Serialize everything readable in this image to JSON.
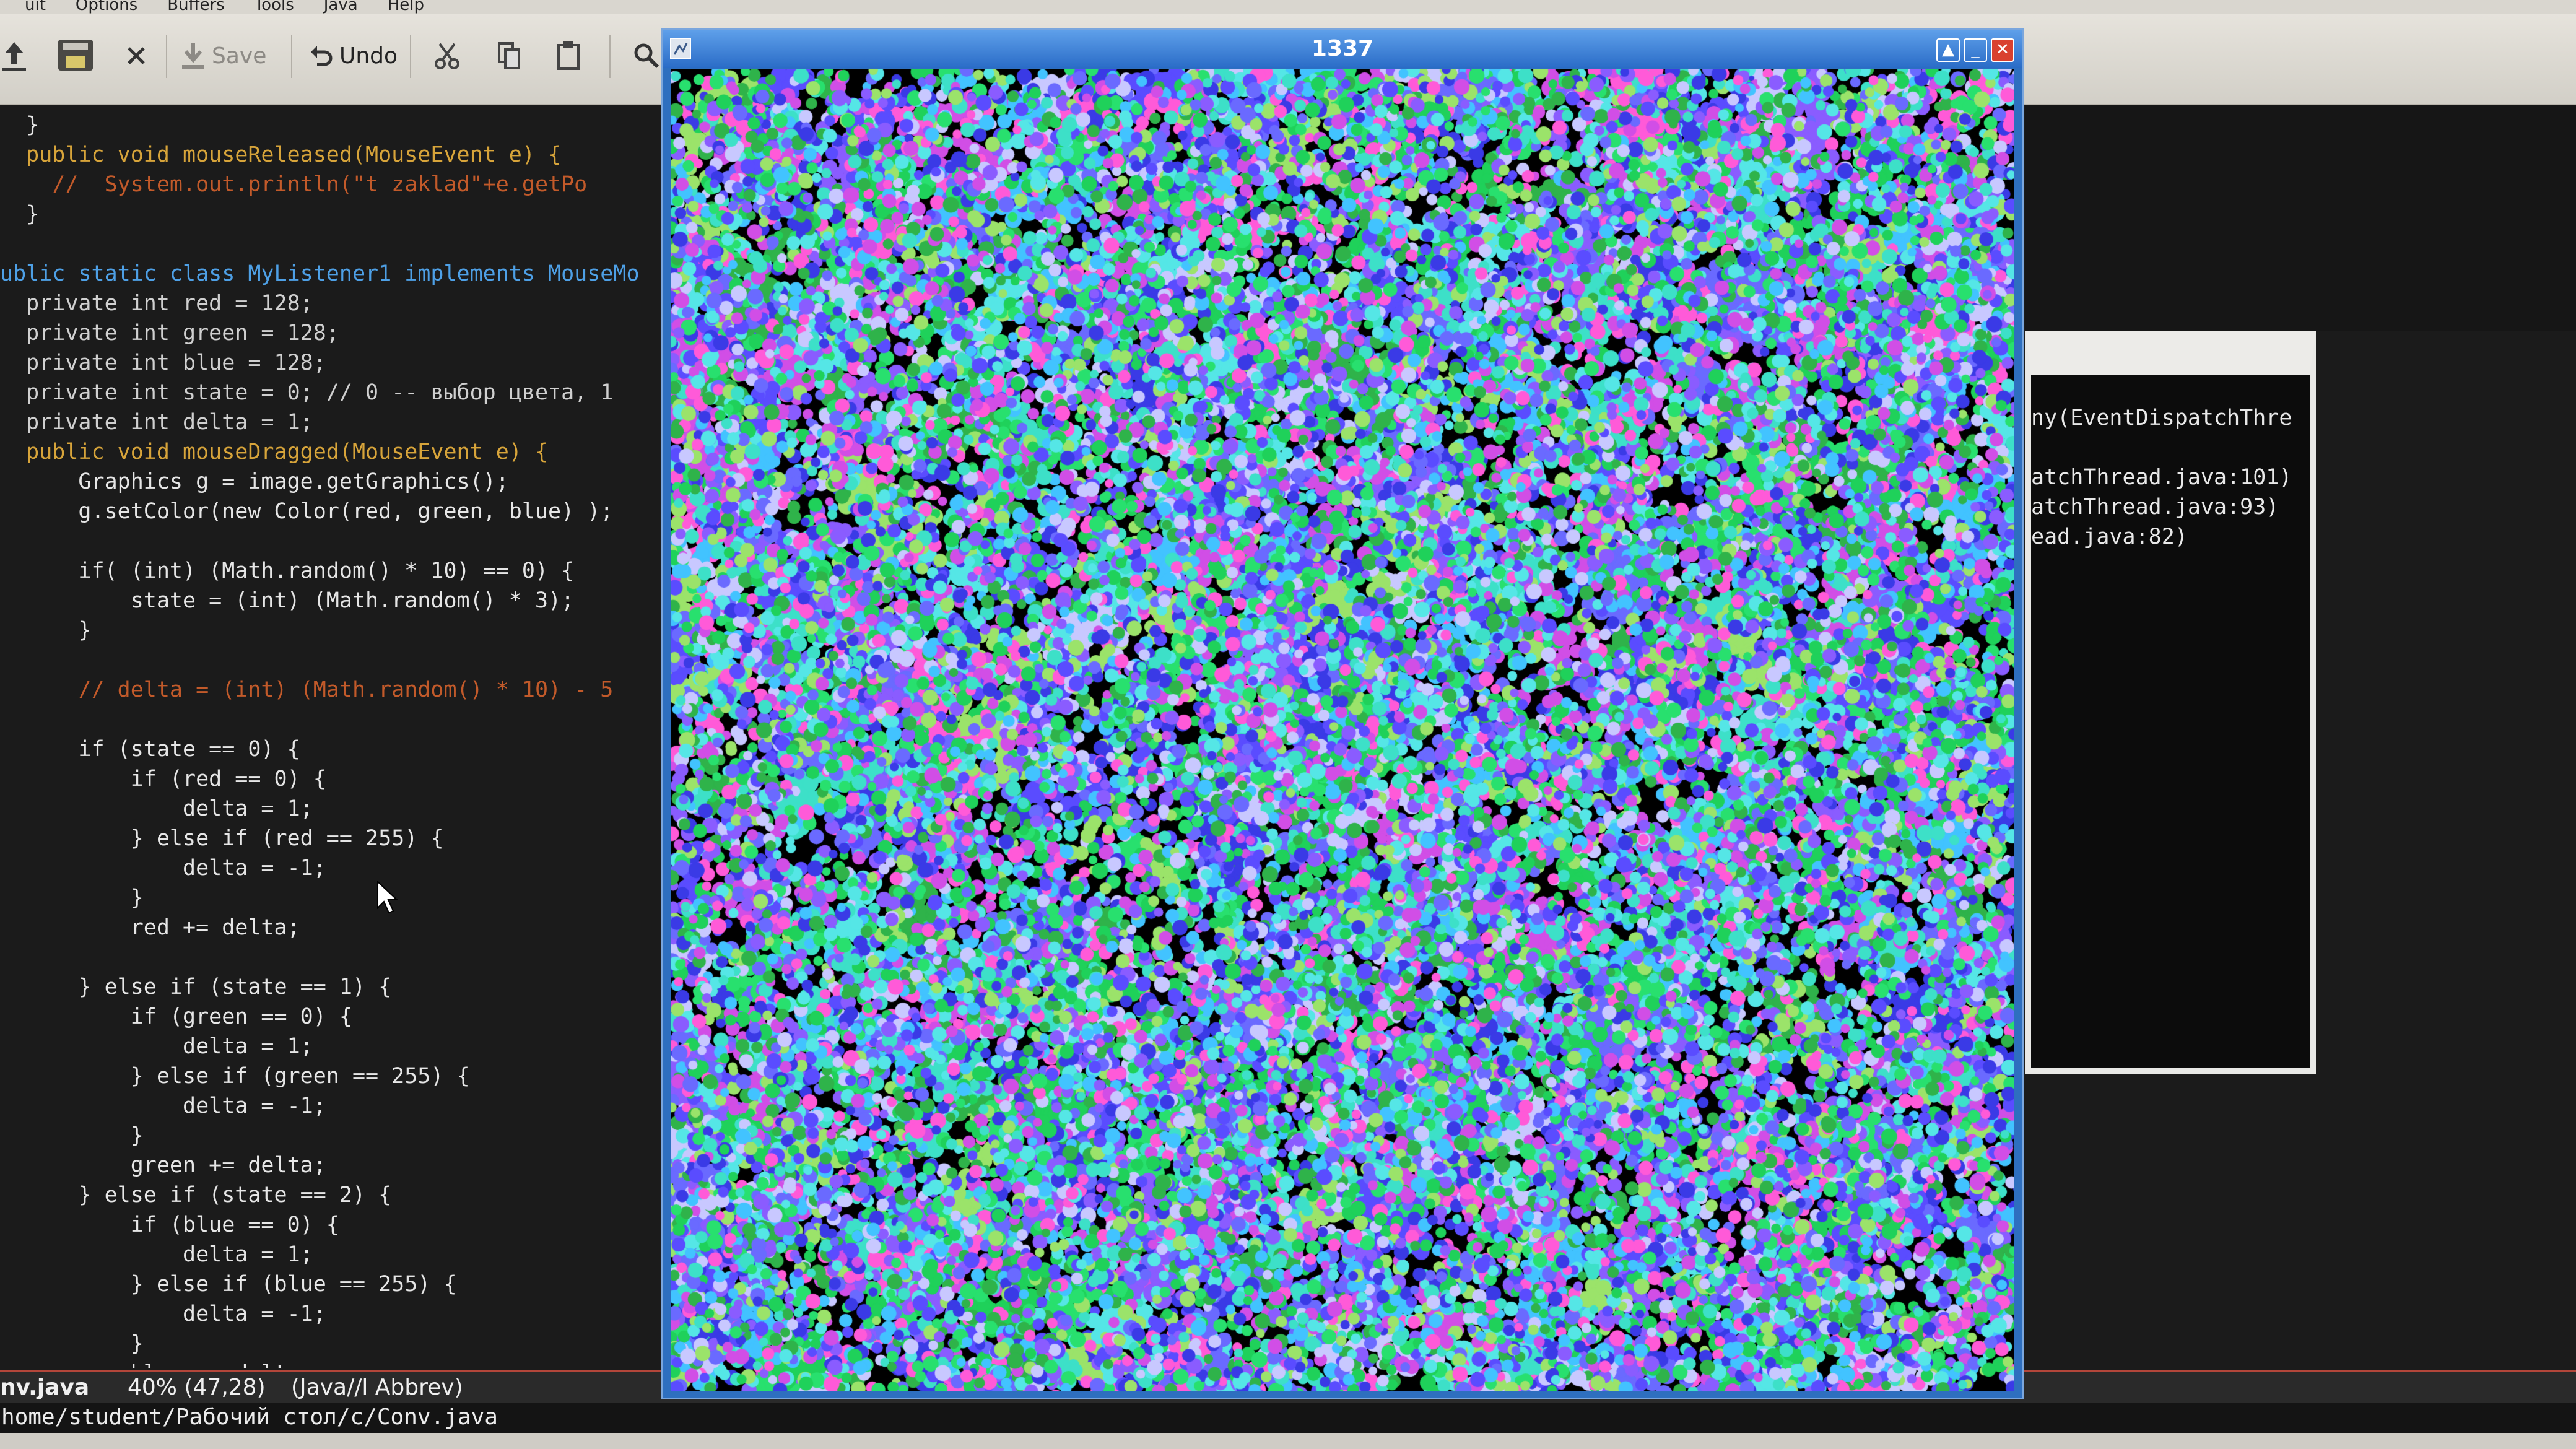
{
  "menu": [
    "uit",
    "Options",
    "Buffers",
    "Tools",
    "Java",
    "Help"
  ],
  "toolbar": {
    "save": "Save",
    "undo": "Undo"
  },
  "code_lines": [
    {
      "t": "  }",
      "c": ""
    },
    {
      "t": "  public void mouseReleased(MouseEvent e) {",
      "c": "mr"
    },
    {
      "t": "    //  System.out.println(\"t zaklad\"+e.getPo",
      "c": "cm"
    },
    {
      "t": "  }",
      "c": ""
    },
    {
      "t": "",
      "c": ""
    },
    {
      "t": "ublic static class MyListener1 implements MouseMo",
      "c": "cls"
    },
    {
      "t": "  private int red = 128;",
      "c": "f"
    },
    {
      "t": "  private int green = 128;",
      "c": "f"
    },
    {
      "t": "  private int blue = 128;",
      "c": "f"
    },
    {
      "t": "  private int state = 0; // 0 -- выбор цвета, 1",
      "c": "f"
    },
    {
      "t": "  private int delta = 1;",
      "c": "f"
    },
    {
      "t": "  public void mouseDragged(MouseEvent e) {",
      "c": "md"
    },
    {
      "t": "      Graphics g = image.getGraphics();",
      "c": ""
    },
    {
      "t": "      g.setColor(new Color(red, green, blue) );",
      "c": ""
    },
    {
      "t": "",
      "c": ""
    },
    {
      "t": "      if( (int) (Math.random() * 10) == 0) {",
      "c": "if"
    },
    {
      "t": "          state = (int) (Math.random() * 3);",
      "c": ""
    },
    {
      "t": "      }",
      "c": ""
    },
    {
      "t": "",
      "c": ""
    },
    {
      "t": "      // delta = (int) (Math.random() * 10) - 5",
      "c": "cm"
    },
    {
      "t": "",
      "c": ""
    },
    {
      "t": "      if (state == 0) {",
      "c": "if"
    },
    {
      "t": "          if (red == 0) {",
      "c": "if"
    },
    {
      "t": "              delta = 1;",
      "c": ""
    },
    {
      "t": "          } else if (red == 255) {",
      "c": "else"
    },
    {
      "t": "              delta = -1;",
      "c": ""
    },
    {
      "t": "          }",
      "c": ""
    },
    {
      "t": "          red += delta;",
      "c": ""
    },
    {
      "t": "",
      "c": ""
    },
    {
      "t": "      } else if (state == 1) {",
      "c": "else"
    },
    {
      "t": "          if (green == 0) {",
      "c": "if"
    },
    {
      "t": "              delta = 1;",
      "c": ""
    },
    {
      "t": "          } else if (green == 255) {",
      "c": "else"
    },
    {
      "t": "              delta = -1;",
      "c": ""
    },
    {
      "t": "          }",
      "c": ""
    },
    {
      "t": "          green += delta;",
      "c": ""
    },
    {
      "t": "      } else if (state == 2) {",
      "c": "else"
    },
    {
      "t": "          if (blue == 0) {",
      "c": "if"
    },
    {
      "t": "              delta = 1;",
      "c": ""
    },
    {
      "t": "          } else if (blue == 255) {",
      "c": "else"
    },
    {
      "t": "              delta = -1;",
      "c": ""
    },
    {
      "t": "          }",
      "c": ""
    },
    {
      "t": "          blue += delta;",
      "c": ""
    }
  ],
  "modeline": {
    "file": "nv.java",
    "pos": "40% (47,28)",
    "mode": "(Java//l Abbrev)"
  },
  "minibuffer": "home/student/Рабочий стол/c/Conv.java",
  "terminal_lines": [
    "ny(EventDispatchThre",
    "",
    "atchThread.java:101)",
    "atchThread.java:93)",
    "ead.java:82)"
  ],
  "window": {
    "title": "1337"
  },
  "colors": {
    "editor_bg": "#1b1b1b",
    "keyword": "#4ea0e6",
    "comment": "#c25a2a",
    "titlebar": "#2a6cc7",
    "modeline_border": "#b3463a"
  }
}
